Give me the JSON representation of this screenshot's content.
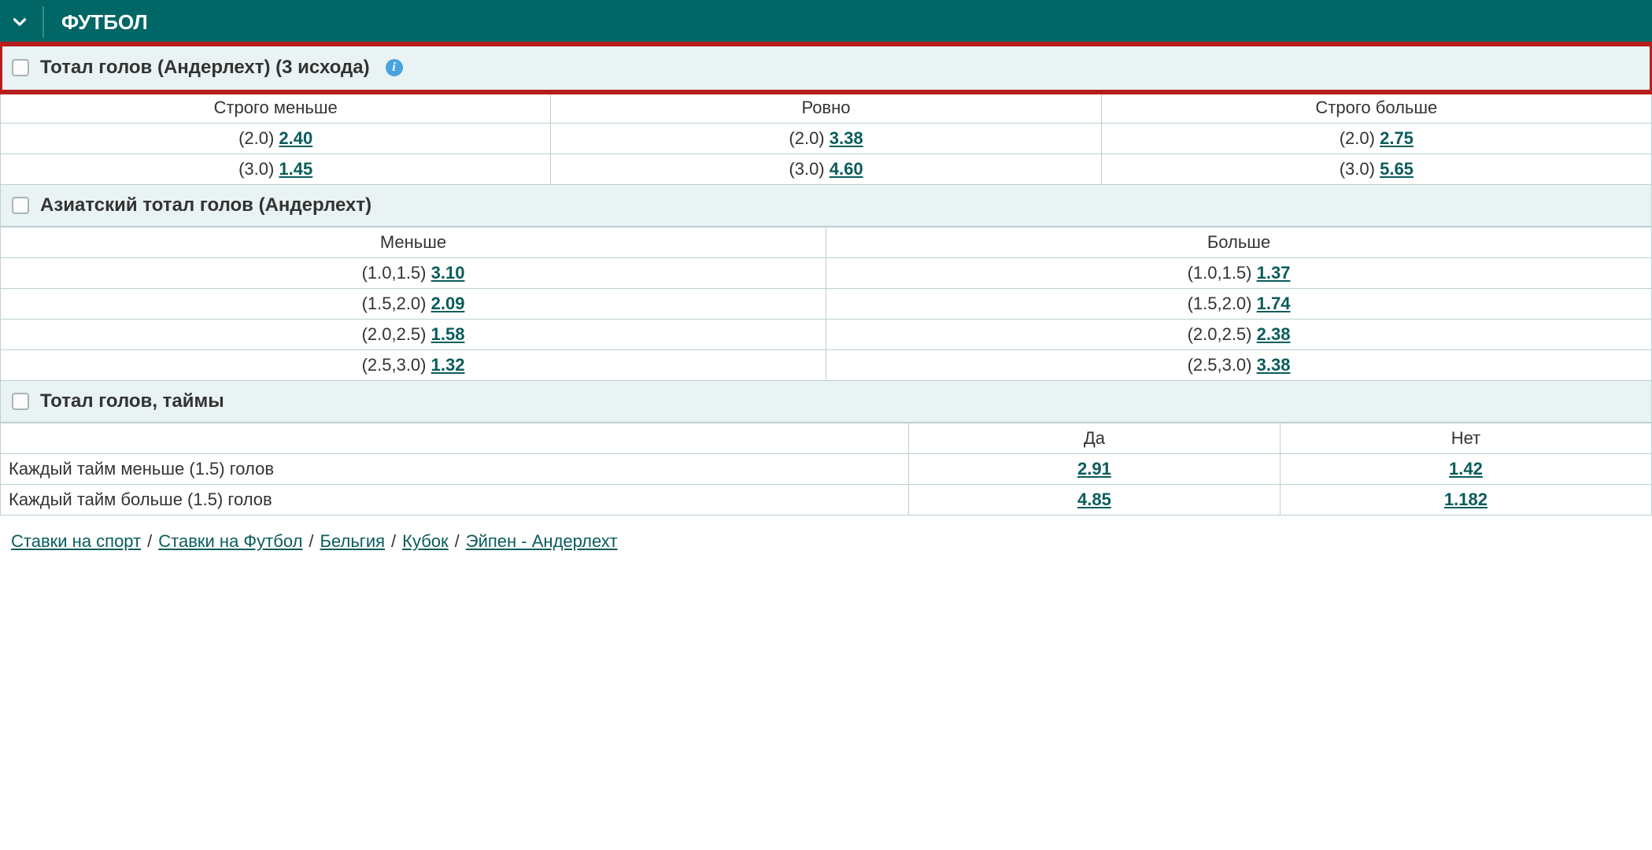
{
  "header": {
    "title": "ФУТБОЛ"
  },
  "section1": {
    "title": "Тотал голов (Андерлехт) (3 исхода)",
    "columns": [
      "Строго меньше",
      "Ровно",
      "Строго больше"
    ],
    "rows": [
      {
        "under": {
          "label": "(2.0)",
          "odds": "2.40"
        },
        "exact": {
          "label": "(2.0)",
          "odds": "3.38"
        },
        "over": {
          "label": "(2.0)",
          "odds": "2.75"
        }
      },
      {
        "under": {
          "label": "(3.0)",
          "odds": "1.45"
        },
        "exact": {
          "label": "(3.0)",
          "odds": "4.60"
        },
        "over": {
          "label": "(3.0)",
          "odds": "5.65"
        }
      }
    ]
  },
  "section2": {
    "title": "Азиатский тотал голов (Андерлехт)",
    "columns": [
      "Меньше",
      "Больше"
    ],
    "rows": [
      {
        "under": {
          "label": "(1.0,1.5)",
          "odds": "3.10"
        },
        "over": {
          "label": "(1.0,1.5)",
          "odds": "1.37"
        }
      },
      {
        "under": {
          "label": "(1.5,2.0)",
          "odds": "2.09"
        },
        "over": {
          "label": "(1.5,2.0)",
          "odds": "1.74"
        }
      },
      {
        "under": {
          "label": "(2.0,2.5)",
          "odds": "1.58"
        },
        "over": {
          "label": "(2.0,2.5)",
          "odds": "2.38"
        }
      },
      {
        "under": {
          "label": "(2.5,3.0)",
          "odds": "1.32"
        },
        "over": {
          "label": "(2.5,3.0)",
          "odds": "3.38"
        }
      }
    ]
  },
  "section3": {
    "title": "Тотал голов, таймы",
    "columns": [
      "",
      "Да",
      "Нет"
    ],
    "rows": [
      {
        "label": "Каждый тайм меньше (1.5) голов",
        "yes": "2.91",
        "no": "1.42"
      },
      {
        "label": "Каждый тайм больше (1.5) голов",
        "yes": "4.85",
        "no": "1.182"
      }
    ]
  },
  "breadcrumb": {
    "items": [
      "Ставки на спорт",
      "Ставки на Футбол",
      "Бельгия",
      "Кубок",
      "Эйпен - Андерлехт"
    ],
    "sep": "/"
  }
}
